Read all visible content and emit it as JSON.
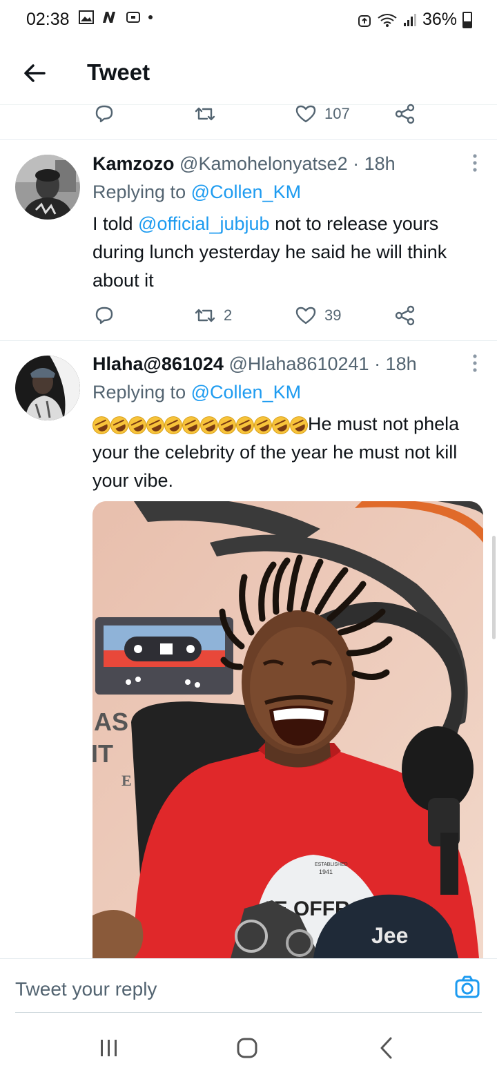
{
  "status_bar": {
    "time": "02:38",
    "battery": "36%"
  },
  "header": {
    "title": "Tweet"
  },
  "top_actions": {
    "like_count": "107"
  },
  "tweets": [
    {
      "name": "Kamzozo",
      "handle": "@Kamohelonyatse2",
      "time": "· 18h",
      "replying_label": "Replying to ",
      "replying_to": "@Collen_KM",
      "text_pre": "I told ",
      "mention": "@official_jubjub",
      "text_post": " not to release yours during lunch yesterday he said he will think about it",
      "retweets": "2",
      "likes": "39"
    },
    {
      "name": "Hlaha@861024",
      "handle": "@Hlaha8610241",
      "time": "· 18h",
      "replying_label": "Replying to ",
      "replying_to": "@Collen_KM",
      "text": "He must not phela your the celebrity of the year he must not kill your vibe.",
      "media_text": {
        "wall_letters_1": "AS",
        "wall_letters_2": "IT",
        "wall_letter_3": "E",
        "shirt_small": "ESTABLISHED",
        "shirt_year": "1941",
        "shirt_main": "JE OFFROAD",
        "cap_brand": "Jee"
      }
    }
  ],
  "reply_bar": {
    "placeholder": "Tweet your reply"
  },
  "colors": {
    "link": "#1d9bf0",
    "muted": "#536471",
    "shirt": "#e0282a"
  }
}
